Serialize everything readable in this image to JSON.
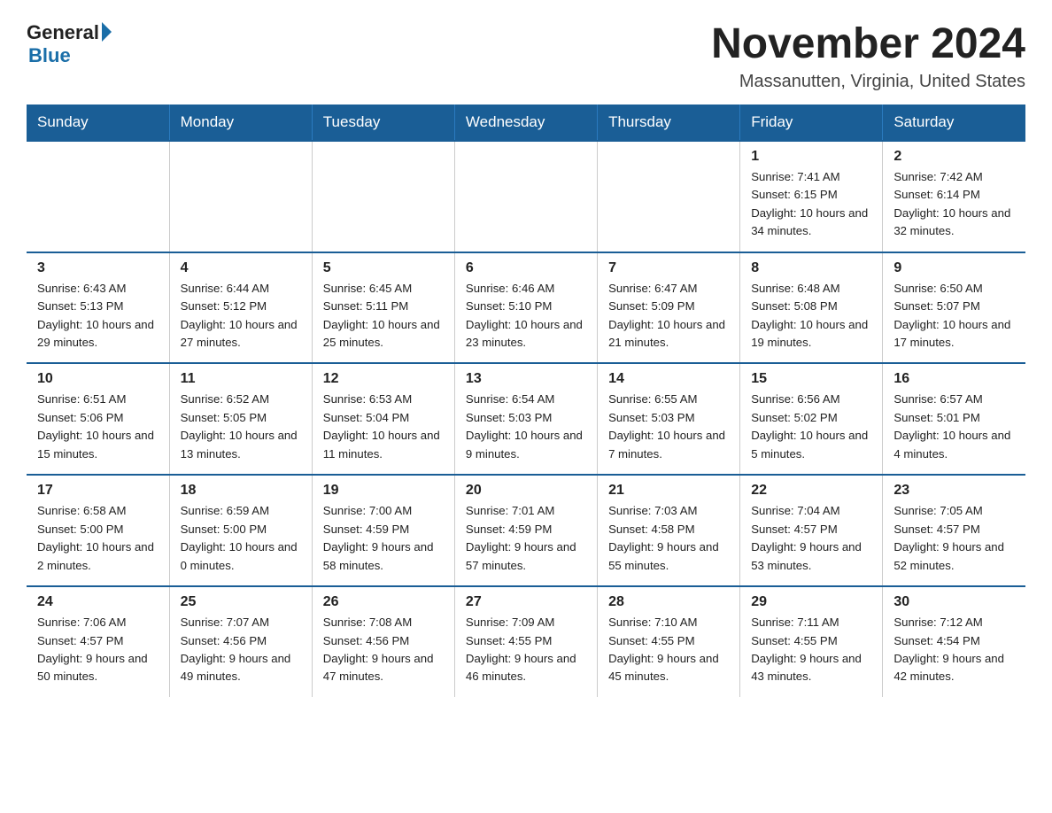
{
  "logo": {
    "general": "General",
    "blue": "Blue"
  },
  "title": "November 2024",
  "subtitle": "Massanutten, Virginia, United States",
  "weekdays": [
    "Sunday",
    "Monday",
    "Tuesday",
    "Wednesday",
    "Thursday",
    "Friday",
    "Saturday"
  ],
  "weeks": [
    [
      {
        "day": "",
        "info": ""
      },
      {
        "day": "",
        "info": ""
      },
      {
        "day": "",
        "info": ""
      },
      {
        "day": "",
        "info": ""
      },
      {
        "day": "",
        "info": ""
      },
      {
        "day": "1",
        "info": "Sunrise: 7:41 AM\nSunset: 6:15 PM\nDaylight: 10 hours\nand 34 minutes."
      },
      {
        "day": "2",
        "info": "Sunrise: 7:42 AM\nSunset: 6:14 PM\nDaylight: 10 hours\nand 32 minutes."
      }
    ],
    [
      {
        "day": "3",
        "info": "Sunrise: 6:43 AM\nSunset: 5:13 PM\nDaylight: 10 hours\nand 29 minutes."
      },
      {
        "day": "4",
        "info": "Sunrise: 6:44 AM\nSunset: 5:12 PM\nDaylight: 10 hours\nand 27 minutes."
      },
      {
        "day": "5",
        "info": "Sunrise: 6:45 AM\nSunset: 5:11 PM\nDaylight: 10 hours\nand 25 minutes."
      },
      {
        "day": "6",
        "info": "Sunrise: 6:46 AM\nSunset: 5:10 PM\nDaylight: 10 hours\nand 23 minutes."
      },
      {
        "day": "7",
        "info": "Sunrise: 6:47 AM\nSunset: 5:09 PM\nDaylight: 10 hours\nand 21 minutes."
      },
      {
        "day": "8",
        "info": "Sunrise: 6:48 AM\nSunset: 5:08 PM\nDaylight: 10 hours\nand 19 minutes."
      },
      {
        "day": "9",
        "info": "Sunrise: 6:50 AM\nSunset: 5:07 PM\nDaylight: 10 hours\nand 17 minutes."
      }
    ],
    [
      {
        "day": "10",
        "info": "Sunrise: 6:51 AM\nSunset: 5:06 PM\nDaylight: 10 hours\nand 15 minutes."
      },
      {
        "day": "11",
        "info": "Sunrise: 6:52 AM\nSunset: 5:05 PM\nDaylight: 10 hours\nand 13 minutes."
      },
      {
        "day": "12",
        "info": "Sunrise: 6:53 AM\nSunset: 5:04 PM\nDaylight: 10 hours\nand 11 minutes."
      },
      {
        "day": "13",
        "info": "Sunrise: 6:54 AM\nSunset: 5:03 PM\nDaylight: 10 hours\nand 9 minutes."
      },
      {
        "day": "14",
        "info": "Sunrise: 6:55 AM\nSunset: 5:03 PM\nDaylight: 10 hours\nand 7 minutes."
      },
      {
        "day": "15",
        "info": "Sunrise: 6:56 AM\nSunset: 5:02 PM\nDaylight: 10 hours\nand 5 minutes."
      },
      {
        "day": "16",
        "info": "Sunrise: 6:57 AM\nSunset: 5:01 PM\nDaylight: 10 hours\nand 4 minutes."
      }
    ],
    [
      {
        "day": "17",
        "info": "Sunrise: 6:58 AM\nSunset: 5:00 PM\nDaylight: 10 hours\nand 2 minutes."
      },
      {
        "day": "18",
        "info": "Sunrise: 6:59 AM\nSunset: 5:00 PM\nDaylight: 10 hours\nand 0 minutes."
      },
      {
        "day": "19",
        "info": "Sunrise: 7:00 AM\nSunset: 4:59 PM\nDaylight: 9 hours\nand 58 minutes."
      },
      {
        "day": "20",
        "info": "Sunrise: 7:01 AM\nSunset: 4:59 PM\nDaylight: 9 hours\nand 57 minutes."
      },
      {
        "day": "21",
        "info": "Sunrise: 7:03 AM\nSunset: 4:58 PM\nDaylight: 9 hours\nand 55 minutes."
      },
      {
        "day": "22",
        "info": "Sunrise: 7:04 AM\nSunset: 4:57 PM\nDaylight: 9 hours\nand 53 minutes."
      },
      {
        "day": "23",
        "info": "Sunrise: 7:05 AM\nSunset: 4:57 PM\nDaylight: 9 hours\nand 52 minutes."
      }
    ],
    [
      {
        "day": "24",
        "info": "Sunrise: 7:06 AM\nSunset: 4:57 PM\nDaylight: 9 hours\nand 50 minutes."
      },
      {
        "day": "25",
        "info": "Sunrise: 7:07 AM\nSunset: 4:56 PM\nDaylight: 9 hours\nand 49 minutes."
      },
      {
        "day": "26",
        "info": "Sunrise: 7:08 AM\nSunset: 4:56 PM\nDaylight: 9 hours\nand 47 minutes."
      },
      {
        "day": "27",
        "info": "Sunrise: 7:09 AM\nSunset: 4:55 PM\nDaylight: 9 hours\nand 46 minutes."
      },
      {
        "day": "28",
        "info": "Sunrise: 7:10 AM\nSunset: 4:55 PM\nDaylight: 9 hours\nand 45 minutes."
      },
      {
        "day": "29",
        "info": "Sunrise: 7:11 AM\nSunset: 4:55 PM\nDaylight: 9 hours\nand 43 minutes."
      },
      {
        "day": "30",
        "info": "Sunrise: 7:12 AM\nSunset: 4:54 PM\nDaylight: 9 hours\nand 42 minutes."
      }
    ]
  ]
}
